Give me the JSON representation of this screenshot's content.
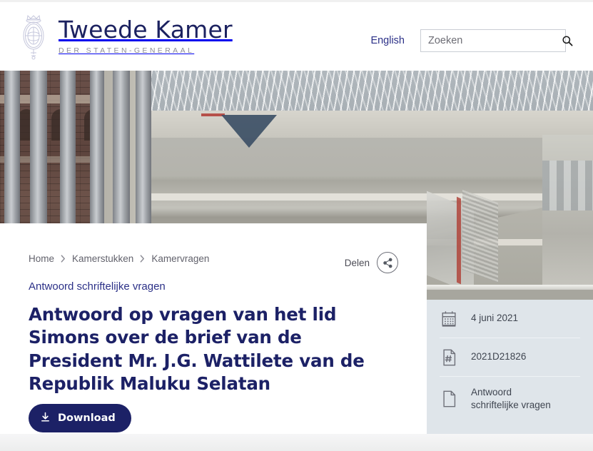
{
  "header": {
    "brand_title": "Tweede Kamer",
    "brand_subtitle": "DER STATEN-GENERAAL",
    "crest_icon": "royal-crest-seal-icon",
    "language_link": "English",
    "search_placeholder": "Zoeken",
    "search_value": "",
    "search_icon": "search-icon"
  },
  "hero": {
    "alt": "Interieur Tweede Kamer atrium met zuilen en roltrappen"
  },
  "breadcrumb": {
    "items": [
      {
        "label": "Home"
      },
      {
        "label": "Kamerstukken"
      },
      {
        "label": "Kamervragen"
      }
    ],
    "separator": "›"
  },
  "share": {
    "label": "Delen",
    "icon": "share-icon"
  },
  "main": {
    "document_type": "Antwoord schriftelijke vragen",
    "title": "Antwoord op vragen van het lid Simons over de brief van de President Mr. J.G. Wattilete van de Republik Maluku Selatan",
    "download_label": "Download",
    "download_icon": "download-icon"
  },
  "meta": {
    "rows": [
      {
        "icon": "calendar-icon",
        "value": "4 juni 2021"
      },
      {
        "icon": "document-number-icon",
        "value": "2021D21826"
      },
      {
        "icon": "document-icon",
        "value": "Antwoord\nschriftelijke vragen"
      }
    ]
  },
  "colors": {
    "brand_navy": "#1c2166",
    "link_blue": "#2b3087",
    "meta_panel_bg": "#dfe5ea",
    "muted_text": "#62626c",
    "icon_gray": "#6d6f78"
  }
}
